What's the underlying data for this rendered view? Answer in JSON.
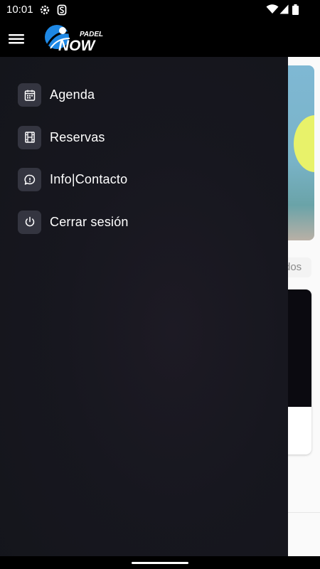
{
  "status_bar": {
    "time": "10:01",
    "icons": [
      "gear-icon",
      "s-notification-icon",
      "wifi-icon",
      "signal-icon",
      "battery-icon"
    ]
  },
  "app_bar": {
    "menu_icon": "hamburger-menu-icon",
    "logo_text_top": "PADEL",
    "logo_text_bottom": "NOW",
    "logo_color": "#1e88e5"
  },
  "drawer": {
    "items": [
      {
        "label": "Agenda",
        "icon": "calendar-icon"
      },
      {
        "label": "Reservas",
        "icon": "film-strip-icon"
      },
      {
        "label": "Info|Contacto",
        "icon": "chat-bubble-icon"
      },
      {
        "label": "Cerrar sesión",
        "icon": "power-icon"
      }
    ]
  },
  "background": {
    "chip_label": "dos"
  },
  "colors": {
    "drawer_bg": "#16161d",
    "icon_tile": "#343540",
    "text": "#ffffff"
  }
}
